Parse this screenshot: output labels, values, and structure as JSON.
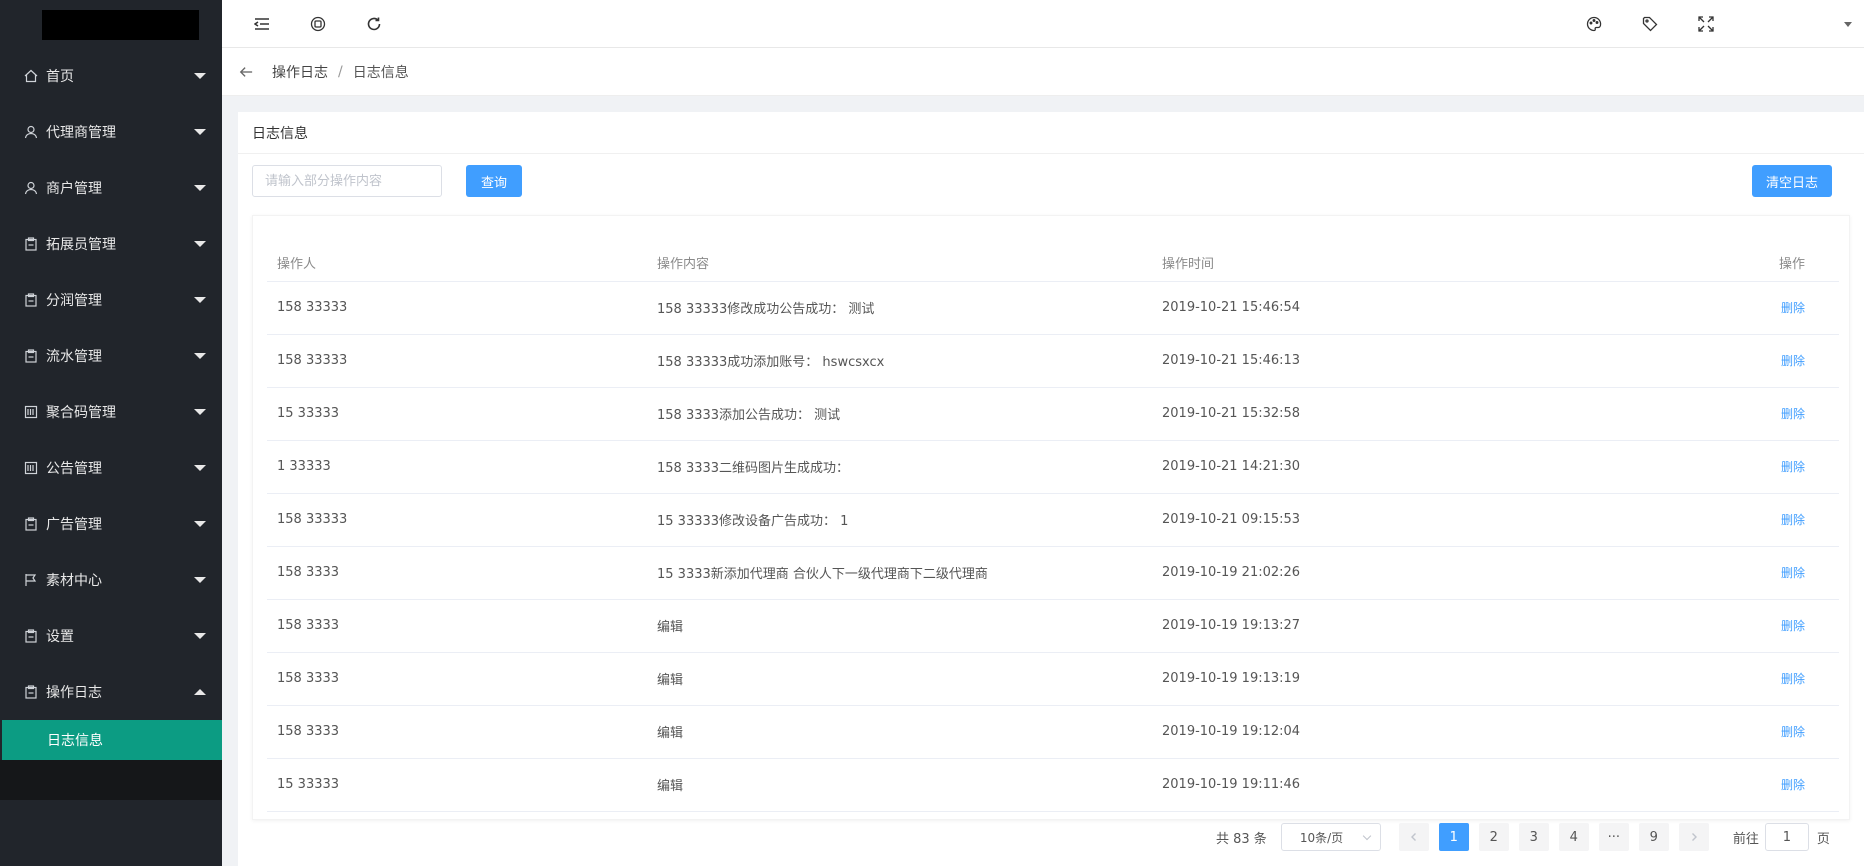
{
  "sidebar": {
    "items": [
      {
        "label": "首页",
        "icon": "home-icon",
        "expanded": false
      },
      {
        "label": "代理商管理",
        "icon": "user-icon",
        "expanded": false
      },
      {
        "label": "商户管理",
        "icon": "user-icon",
        "expanded": false
      },
      {
        "label": "拓展员管理",
        "icon": "clipboard-icon",
        "expanded": false
      },
      {
        "label": "分润管理",
        "icon": "clipboard-icon",
        "expanded": false
      },
      {
        "label": "流水管理",
        "icon": "clipboard-icon",
        "expanded": false
      },
      {
        "label": "聚合码管理",
        "icon": "barcode-icon",
        "expanded": false
      },
      {
        "label": "公告管理",
        "icon": "barcode-icon",
        "expanded": false
      },
      {
        "label": "广告管理",
        "icon": "clipboard-icon",
        "expanded": false
      },
      {
        "label": "素材中心",
        "icon": "flag-icon",
        "expanded": false
      },
      {
        "label": "设置",
        "icon": "clipboard-icon",
        "expanded": false
      },
      {
        "label": "操作日志",
        "icon": "clipboard-icon",
        "expanded": true
      }
    ],
    "submenu": {
      "label": "日志信息",
      "active_color": "#0c9c83"
    }
  },
  "topbar": {
    "icons": [
      "menu-fold-icon",
      "language-icon",
      "refresh-icon",
      "palette-icon",
      "tag-icon",
      "fullscreen-icon"
    ]
  },
  "breadcrumb": {
    "parent": "操作日志",
    "separator": "/",
    "current": "日志信息"
  },
  "card": {
    "title": "日志信息",
    "search_placeholder": "请输入部分操作内容",
    "query_label": "查询",
    "clear_label": "清空日志"
  },
  "table": {
    "headers": {
      "operator": "操作人",
      "content": "操作内容",
      "time": "操作时间",
      "action": "操作"
    },
    "rows": [
      {
        "operator": "158 33333",
        "content": "158 33333修改成功公告成功： 测试",
        "time": "2019-10-21 15:46:54",
        "action": "删除"
      },
      {
        "operator": "158 33333",
        "content": "158 33333成功添加账号： hswcsxcx",
        "time": "2019-10-21 15:46:13",
        "action": "删除"
      },
      {
        "operator": "15 33333",
        "content": "158 3333添加公告成功： 测试",
        "time": "2019-10-21 15:32:58",
        "action": "删除"
      },
      {
        "operator": "1 33333",
        "content": "158 3333二维码图片生成成功：",
        "time": "2019-10-21 14:21:30",
        "action": "删除"
      },
      {
        "operator": "158 33333",
        "content": "15 33333修改设备广告成功： 1",
        "time": "2019-10-21 09:15:53",
        "action": "删除"
      },
      {
        "operator": "158 3333",
        "content": "15 3333新添加代理商 合伙人下一级代理商下二级代理商",
        "time": "2019-10-19 21:02:26",
        "action": "删除"
      },
      {
        "operator": "158 3333",
        "content": "编辑",
        "time": "2019-10-19 19:13:27",
        "action": "删除"
      },
      {
        "operator": "158 3333",
        "content": "编辑",
        "time": "2019-10-19 19:13:19",
        "action": "删除"
      },
      {
        "operator": "158 3333",
        "content": "编辑",
        "time": "2019-10-19 19:12:04",
        "action": "删除"
      },
      {
        "operator": "15 33333",
        "content": "编辑",
        "time": "2019-10-19 19:11:46",
        "action": "删除"
      }
    ]
  },
  "pagination": {
    "total_text": "共 83 条",
    "page_size": "10条/页",
    "pages": [
      "1",
      "2",
      "3",
      "4",
      "···",
      "9"
    ],
    "current_page": "1",
    "goto_label": "前往",
    "goto_value": "1",
    "goto_unit": "页"
  },
  "colors": {
    "sidebar_bg": "#21252b",
    "accent": "#409eff",
    "active_menu": "#0c9c83"
  }
}
